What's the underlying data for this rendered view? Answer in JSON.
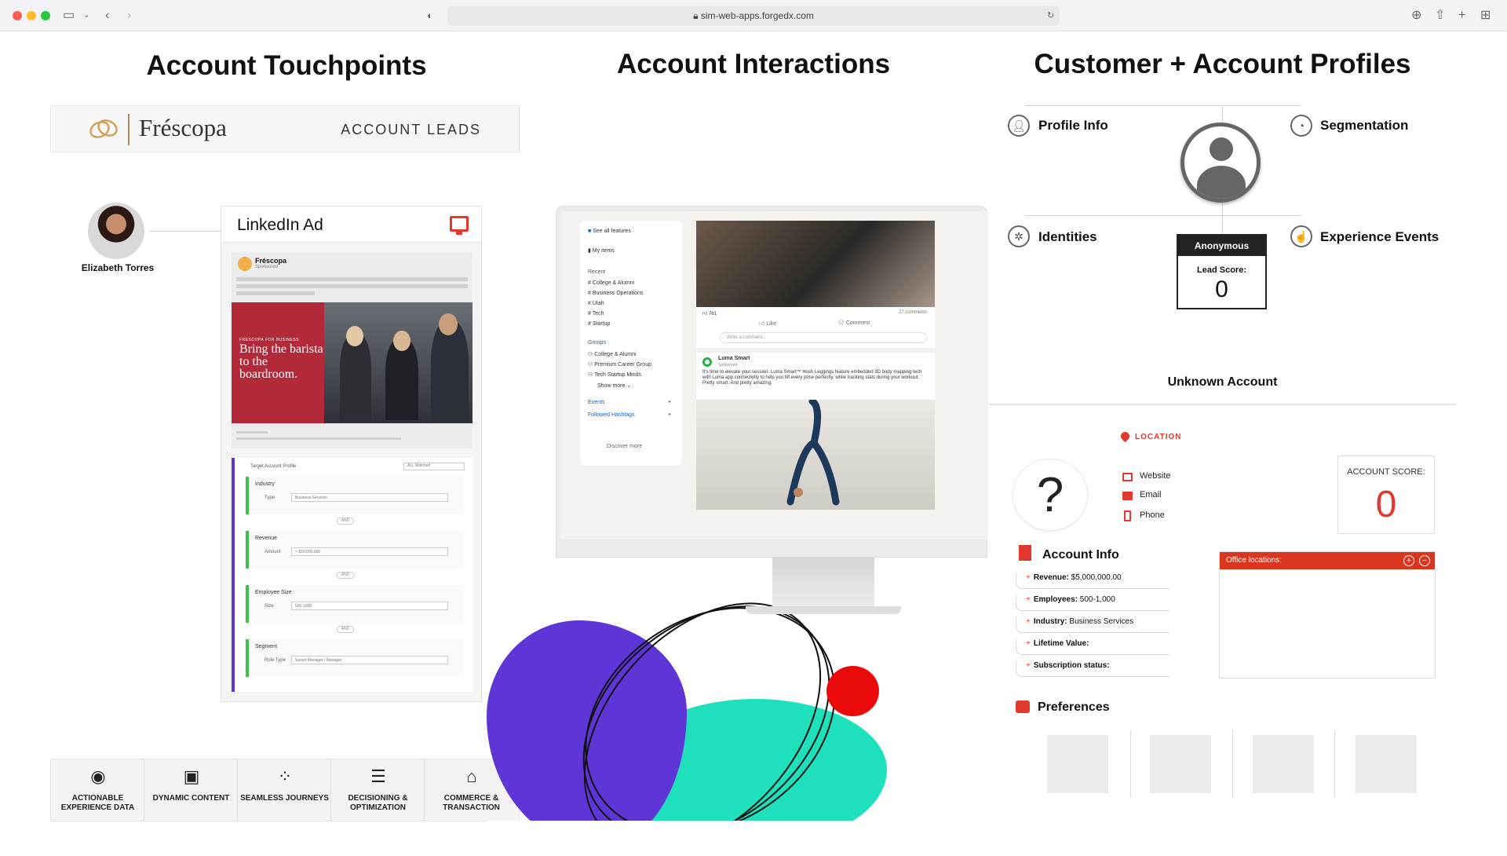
{
  "browser": {
    "url": "sim-web-apps.forgedx.com",
    "buttons": [
      "sidebar-toggle-icon",
      "back-icon",
      "forward-icon",
      "shield-icon",
      "reload-icon",
      "download-icon",
      "share-icon",
      "new-tab-icon",
      "tab-overview-icon"
    ]
  },
  "touchpoints": {
    "title": "Account Touchpoints",
    "brand_name": "Fréscopa",
    "brand_tag": "ACCOUNT LEADS",
    "person_name": "Elizabeth Torres",
    "card_title": "LinkedIn Ad",
    "post_brand": "Fréscopa",
    "post_sponsored": "Sponsored",
    "ad_small": "FRESCOPA FOR BUSINESS",
    "ad_headline": "Bring the barista to the boardroom.",
    "tap_header": "Target Account Profile",
    "tap_select": "ALL Matched",
    "conditions": [
      {
        "label": "Industry",
        "key": "Type",
        "value": "Business Services"
      },
      {
        "label": "Revenue",
        "key": "Amount",
        "value": "> $10,000,000"
      },
      {
        "label": "Employee Size",
        "key": "Size",
        "value": "500-1000"
      },
      {
        "label": "Segment",
        "key": "Role Type",
        "value": "Senior Manager / Manager"
      }
    ],
    "and_label": "AND"
  },
  "features": [
    {
      "icon": "experience-data-icon",
      "label": "ACTIONABLE EXPERIENCE DATA"
    },
    {
      "icon": "dynamic-content-icon",
      "label": "DYNAMIC CONTENT"
    },
    {
      "icon": "journeys-icon",
      "label": "SEAMLESS JOURNEYS"
    },
    {
      "icon": "sliders-icon",
      "label": "DECISIONING & OPTIMIZATION"
    },
    {
      "icon": "commerce-icon",
      "label": "COMMERCE & TRANSACTION"
    }
  ],
  "interactions": {
    "title": "Account Interactions",
    "sidebar": {
      "see_all": "See all features",
      "my_items": "My items",
      "recent_label": "Recent",
      "recent": [
        "College & Alumni",
        "Business Operations",
        "Utah",
        "Tech",
        "Startup"
      ],
      "groups_label": "Groups",
      "groups": [
        "College & Alumni",
        "Premium Career Group",
        "Tech Startup Minds"
      ],
      "show_more": "Show more",
      "events": "Events",
      "hashtags": "Followed Hashtags",
      "discover": "Discover more"
    },
    "feed": {
      "reactions": "761",
      "comments": "27 comments",
      "like": "Like",
      "comment": "Comment",
      "write_placeholder": "Write a comment...",
      "post_author": "Luma Smart",
      "post_sponsored": "Sponsored",
      "post_text": "It's time to elevate your session. Luma Smart™ Hosh Leggings feature embedded 3D body mapping tech with Luma app connectivity to help you hit every pose perfectly, while tracking stats during your workout. Pretty smart. And pretty amazing."
    }
  },
  "profiles": {
    "title": "Customer + Account Profiles",
    "nodes": {
      "profile_info": "Profile Info",
      "segmentation": "Segmentation",
      "identities": "Identities",
      "experience_events": "Experience Events"
    },
    "anon_label": "Anonymous",
    "lead_score_label": "Lead Score:",
    "lead_score": "0",
    "unknown_account": "Unknown Account",
    "location_label": "LOCATION",
    "contacts": [
      "Website",
      "Email",
      "Phone"
    ],
    "account_score_label": "ACCOUNT SCORE:",
    "account_score": "0",
    "account_info_label": "Account Info",
    "account_info": [
      {
        "k": "Revenue:",
        "v": "$5,000,000.00"
      },
      {
        "k": "Employees:",
        "v": "500-1,000"
      },
      {
        "k": "Industry:",
        "v": "Business Services"
      },
      {
        "k": "Lifetime Value:",
        "v": ""
      },
      {
        "k": "Subscription status:",
        "v": ""
      }
    ],
    "office_label": "Office locations:",
    "preferences_label": "Preferences",
    "accent": "#e03a2f"
  }
}
